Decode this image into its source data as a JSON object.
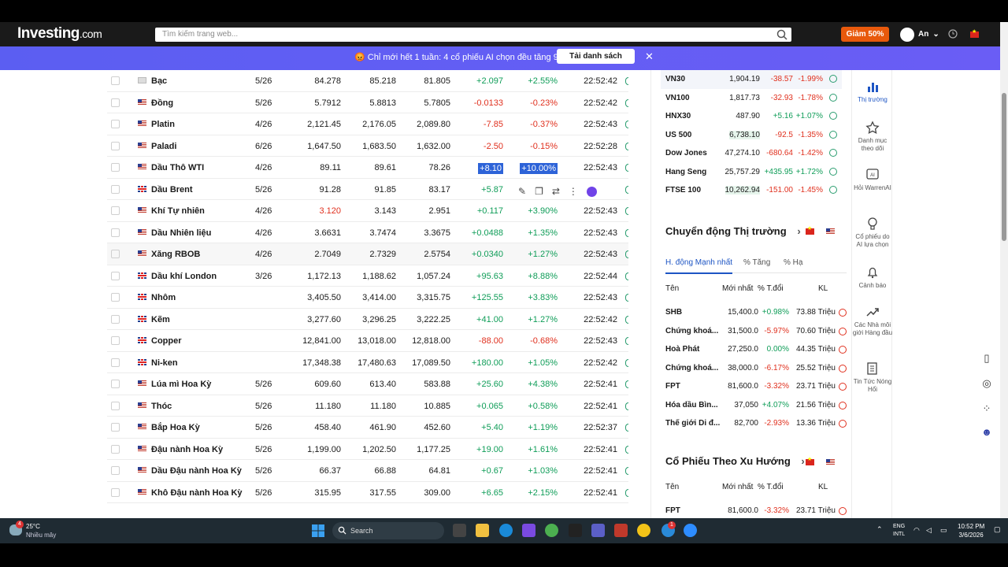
{
  "header": {
    "logo_main": "Investing",
    "logo_suffix": ".com",
    "search_placeholder": "Tìm kiếm trang web...",
    "promo_label": "Giảm 50%",
    "user_name": "An"
  },
  "banner": {
    "message": "Chỉ mới hết 1 tuần: 4 cổ phiếu AI chọn đều tăng 9%",
    "cta": "Tải danh sách"
  },
  "commodities": [
    {
      "name": "Bạc",
      "flag": "silver",
      "month": "5/26",
      "last": "84.278",
      "high": "85.218",
      "low": "81.805",
      "chg": "+2.097",
      "pct": "+2.55%",
      "time": "22:52:42",
      "dir": "pos"
    },
    {
      "name": "Đồng",
      "flag": "us",
      "month": "5/26",
      "last": "5.7912",
      "high": "5.8813",
      "low": "5.7805",
      "chg": "-0.0133",
      "pct": "-0.23%",
      "time": "22:52:42",
      "dir": "neg"
    },
    {
      "name": "Platin",
      "flag": "us",
      "month": "4/26",
      "last": "2,121.45",
      "high": "2,176.05",
      "low": "2,089.80",
      "chg": "-7.85",
      "pct": "-0.37%",
      "time": "22:52:43",
      "dir": "neg"
    },
    {
      "name": "Paladi",
      "flag": "us",
      "month": "6/26",
      "last": "1,647.50",
      "high": "1,683.50",
      "low": "1,632.00",
      "chg": "-2.50",
      "pct": "-0.15%",
      "time": "22:52:28",
      "dir": "neg"
    },
    {
      "name": "Dầu Thô WTI",
      "flag": "us",
      "month": "4/26",
      "last": "89.11",
      "high": "89.61",
      "low": "78.26",
      "chg": "+8.10",
      "pct": "+10.00%",
      "time": "22:52:43",
      "dir": "pos"
    },
    {
      "name": "Dầu Brent",
      "flag": "uk",
      "month": "5/26",
      "last": "91.28",
      "high": "91.85",
      "low": "83.17",
      "chg": "+5.87",
      "pct": "",
      "time": "",
      "dir": "pos"
    },
    {
      "name": "Khí Tự nhiên",
      "flag": "us",
      "month": "4/26",
      "last": "3.120",
      "high": "3.143",
      "low": "2.951",
      "chg": "+0.117",
      "pct": "+3.90%",
      "time": "22:52:43",
      "dir": "pos"
    },
    {
      "name": "Dầu Nhiên liệu",
      "flag": "us",
      "month": "4/26",
      "last": "3.6631",
      "high": "3.7474",
      "low": "3.3675",
      "chg": "+0.0488",
      "pct": "+1.35%",
      "time": "22:52:43",
      "dir": "pos"
    },
    {
      "name": "Xăng RBOB",
      "flag": "us",
      "month": "4/26",
      "last": "2.7049",
      "high": "2.7329",
      "low": "2.5754",
      "chg": "+0.0340",
      "pct": "+1.27%",
      "time": "22:52:43",
      "dir": "pos"
    },
    {
      "name": "Dầu khí London",
      "flag": "uk",
      "month": "3/26",
      "last": "1,172.13",
      "high": "1,188.62",
      "low": "1,057.24",
      "chg": "+95.63",
      "pct": "+8.88%",
      "time": "22:52:44",
      "dir": "pos"
    },
    {
      "name": "Nhôm",
      "flag": "uk",
      "month": "",
      "last": "3,405.50",
      "high": "3,414.00",
      "low": "3,315.75",
      "chg": "+125.55",
      "pct": "+3.83%",
      "time": "22:52:43",
      "dir": "pos"
    },
    {
      "name": "Kẽm",
      "flag": "uk",
      "month": "",
      "last": "3,277.60",
      "high": "3,296.25",
      "low": "3,222.25",
      "chg": "+41.00",
      "pct": "+1.27%",
      "time": "22:52:42",
      "dir": "pos"
    },
    {
      "name": "Copper",
      "flag": "uk",
      "month": "",
      "last": "12,841.00",
      "high": "13,018.00",
      "low": "12,818.00",
      "chg": "-88.00",
      "pct": "-0.68%",
      "time": "22:52:43",
      "dir": "neg"
    },
    {
      "name": "Ni-ken",
      "flag": "uk",
      "month": "",
      "last": "17,348.38",
      "high": "17,480.63",
      "low": "17,089.50",
      "chg": "+180.00",
      "pct": "+1.05%",
      "time": "22:52:42",
      "dir": "pos"
    },
    {
      "name": "Lúa mì Hoa Kỳ",
      "flag": "us",
      "month": "5/26",
      "last": "609.60",
      "high": "613.40",
      "low": "583.88",
      "chg": "+25.60",
      "pct": "+4.38%",
      "time": "22:52:41",
      "dir": "pos"
    },
    {
      "name": "Thóc",
      "flag": "us",
      "month": "5/26",
      "last": "11.180",
      "high": "11.180",
      "low": "10.885",
      "chg": "+0.065",
      "pct": "+0.58%",
      "time": "22:52:41",
      "dir": "pos"
    },
    {
      "name": "Bắp Hoa Kỳ",
      "flag": "us",
      "month": "5/26",
      "last": "458.40",
      "high": "461.90",
      "low": "452.60",
      "chg": "+5.40",
      "pct": "+1.19%",
      "time": "22:52:37",
      "dir": "pos"
    },
    {
      "name": "Đậu nành Hoa Kỳ",
      "flag": "us",
      "month": "5/26",
      "last": "1,199.00",
      "high": "1,202.50",
      "low": "1,177.25",
      "chg": "+19.00",
      "pct": "+1.61%",
      "time": "22:52:41",
      "dir": "pos"
    },
    {
      "name": "Dầu Đậu nành Hoa Kỳ",
      "flag": "us",
      "month": "5/26",
      "last": "66.37",
      "high": "66.88",
      "low": "64.81",
      "chg": "+0.67",
      "pct": "+1.03%",
      "time": "22:52:41",
      "dir": "pos"
    },
    {
      "name": "Khô Đậu nành Hoa Kỳ",
      "flag": "us",
      "month": "5/26",
      "last": "315.95",
      "high": "317.55",
      "low": "309.00",
      "chg": "+6.65",
      "pct": "+2.15%",
      "time": "22:52:41",
      "dir": "pos"
    }
  ],
  "indices": [
    {
      "name": "VN30",
      "value": "1,904.19",
      "chg": "-38.57",
      "pct": "-1.99%",
      "dir": "neg"
    },
    {
      "name": "VN100",
      "value": "1,817.73",
      "chg": "-32.93",
      "pct": "-1.78%",
      "dir": "neg"
    },
    {
      "name": "HNX30",
      "value": "487.90",
      "chg": "+5.16",
      "pct": "+1.07%",
      "dir": "pos"
    },
    {
      "name": "US 500",
      "value": "6,738.10",
      "chg": "-92.5",
      "pct": "-1.35%",
      "dir": "neg"
    },
    {
      "name": "Dow Jones",
      "value": "47,274.10",
      "chg": "-680.64",
      "pct": "-1.42%",
      "dir": "neg"
    },
    {
      "name": "Hang Seng",
      "value": "25,757.29",
      "chg": "+435.95",
      "pct": "+1.72%",
      "dir": "pos"
    },
    {
      "name": "FTSE 100",
      "value": "10,262.94",
      "chg": "-151.00",
      "pct": "-1.45%",
      "dir": "neg"
    }
  ],
  "market_moves": {
    "title": "Chuyển động Thị trường",
    "tabs": [
      "H. động Mạnh nhất",
      "% Tăng",
      "% Hạ"
    ],
    "columns": [
      "Tên",
      "Mới nhất",
      "% T.đổi",
      "KL"
    ],
    "rows": [
      {
        "name": "SHB",
        "price": "15,400.0",
        "pct": "+0.98%",
        "vol": "73.88 Triệu",
        "dir": "pos"
      },
      {
        "name": "Chứng khoá...",
        "price": "31,500.0",
        "pct": "-5.97%",
        "vol": "70.60 Triệu",
        "dir": "neg"
      },
      {
        "name": "Hoà Phát",
        "price": "27,250.0",
        "pct": "0.00%",
        "vol": "44.35 Triệu",
        "dir": "pos"
      },
      {
        "name": "Chứng khoá...",
        "price": "38,000.0",
        "pct": "-6.17%",
        "vol": "25.52 Triệu",
        "dir": "neg"
      },
      {
        "name": "FPT",
        "price": "81,600.0",
        "pct": "-3.32%",
        "vol": "23.71 Triệu",
        "dir": "neg"
      },
      {
        "name": "Hóa dầu Bìn...",
        "price": "37,050",
        "pct": "+4.07%",
        "vol": "21.56 Triệu",
        "dir": "pos"
      },
      {
        "name": "Thế giới Di đ...",
        "price": "82,700",
        "pct": "-2.93%",
        "vol": "13.36 Triệu",
        "dir": "neg"
      }
    ]
  },
  "trending": {
    "title": "Cổ Phiếu Theo Xu Hướng",
    "columns": [
      "Tên",
      "Mới nhất",
      "% T.đổi",
      "KL"
    ],
    "rows": [
      {
        "name": "FPT",
        "price": "81,600.0",
        "pct": "-3.32%",
        "vol": "23.71 Triệu",
        "dir": "neg"
      }
    ]
  },
  "sidebar": [
    {
      "label": "Thị trường",
      "icon": "bar-chart-icon"
    },
    {
      "label": "Danh mục theo dõi",
      "icon": "star-icon"
    },
    {
      "label": "Hỏi WarrenAI",
      "icon": "ai-icon"
    },
    {
      "label": "Cổ phiếu do AI lựa chọn",
      "icon": "bulb-icon"
    },
    {
      "label": "Cảnh báo",
      "icon": "bell-icon"
    },
    {
      "label": "Các Nhà môi giới Hàng đầu",
      "icon": "trend-icon"
    },
    {
      "label": "Tin Tức Nóng Hổi",
      "icon": "news-icon"
    }
  ],
  "taskbar": {
    "weather_temp": "25°C",
    "weather_desc": "Nhiều mây",
    "weather_badge": "4",
    "search_label": "Search",
    "lang_line1": "ENG",
    "lang_line2": "INTL",
    "time": "10:52 PM",
    "date": "3/6/2026",
    "mail_badge": "1"
  },
  "colors": {
    "positive": "#0f9d58",
    "negative": "#e0301e",
    "accent": "#1d55c4",
    "banner": "#5b5ef2",
    "promo": "#e8590c"
  }
}
